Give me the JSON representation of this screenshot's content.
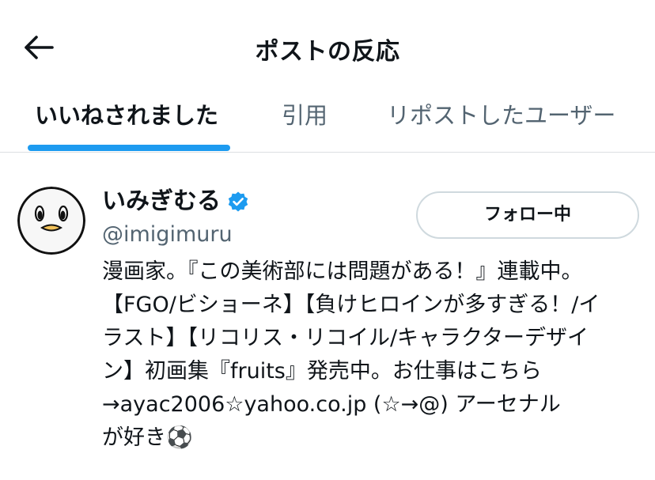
{
  "header": {
    "title": "ポストの反応",
    "back_icon": "arrow-left-icon"
  },
  "tabs": [
    {
      "label": "いいねされました",
      "active": true
    },
    {
      "label": "引用",
      "active": false
    },
    {
      "label": "リポストしたユーザー",
      "active": false
    }
  ],
  "user": {
    "display_name": "いみぎむる",
    "handle": "@imigimuru",
    "verified": true,
    "verified_icon": "verified-badge-icon",
    "avatar_icon": "penguin-avatar",
    "follow_button_label": "フォロー中",
    "bio": "漫画家。『この美術部には問題がある！』連載中。\n【FGO/ビショーネ】【負けヒロインが多すぎる！/イ\nラスト】【リコリス・リコイル/キャラクターデザイ\nン】初画集『fruits』発売中。お仕事はこちら\n→ayac2006☆yahoo.co.jp (☆→@) アーセナル\nが好き⚽"
  },
  "colors": {
    "accent": "#1d9bf0",
    "text_primary": "#0f1419",
    "text_secondary": "#536471",
    "divider": "#dcdfe2"
  }
}
